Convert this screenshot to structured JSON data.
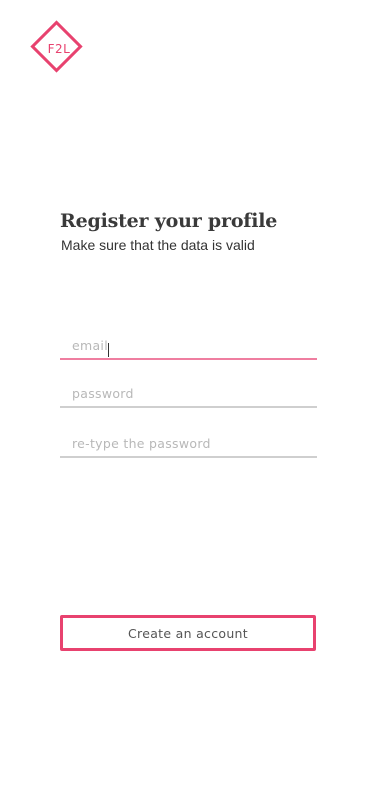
{
  "logo": {
    "text": "F2L",
    "color": "#e8426f"
  },
  "register": {
    "title": "Register your profile",
    "subtitle": "Make sure that the data is valid"
  },
  "form": {
    "email_placeholder": "email",
    "password_placeholder": "password",
    "retype_placeholder": "re-type the password",
    "focused_field": "email"
  },
  "actions": {
    "create_label": "Create an account"
  },
  "colors": {
    "accent": "#e8426f",
    "focus_underline": "#ef7ea0",
    "underline": "#cfcfcf"
  }
}
